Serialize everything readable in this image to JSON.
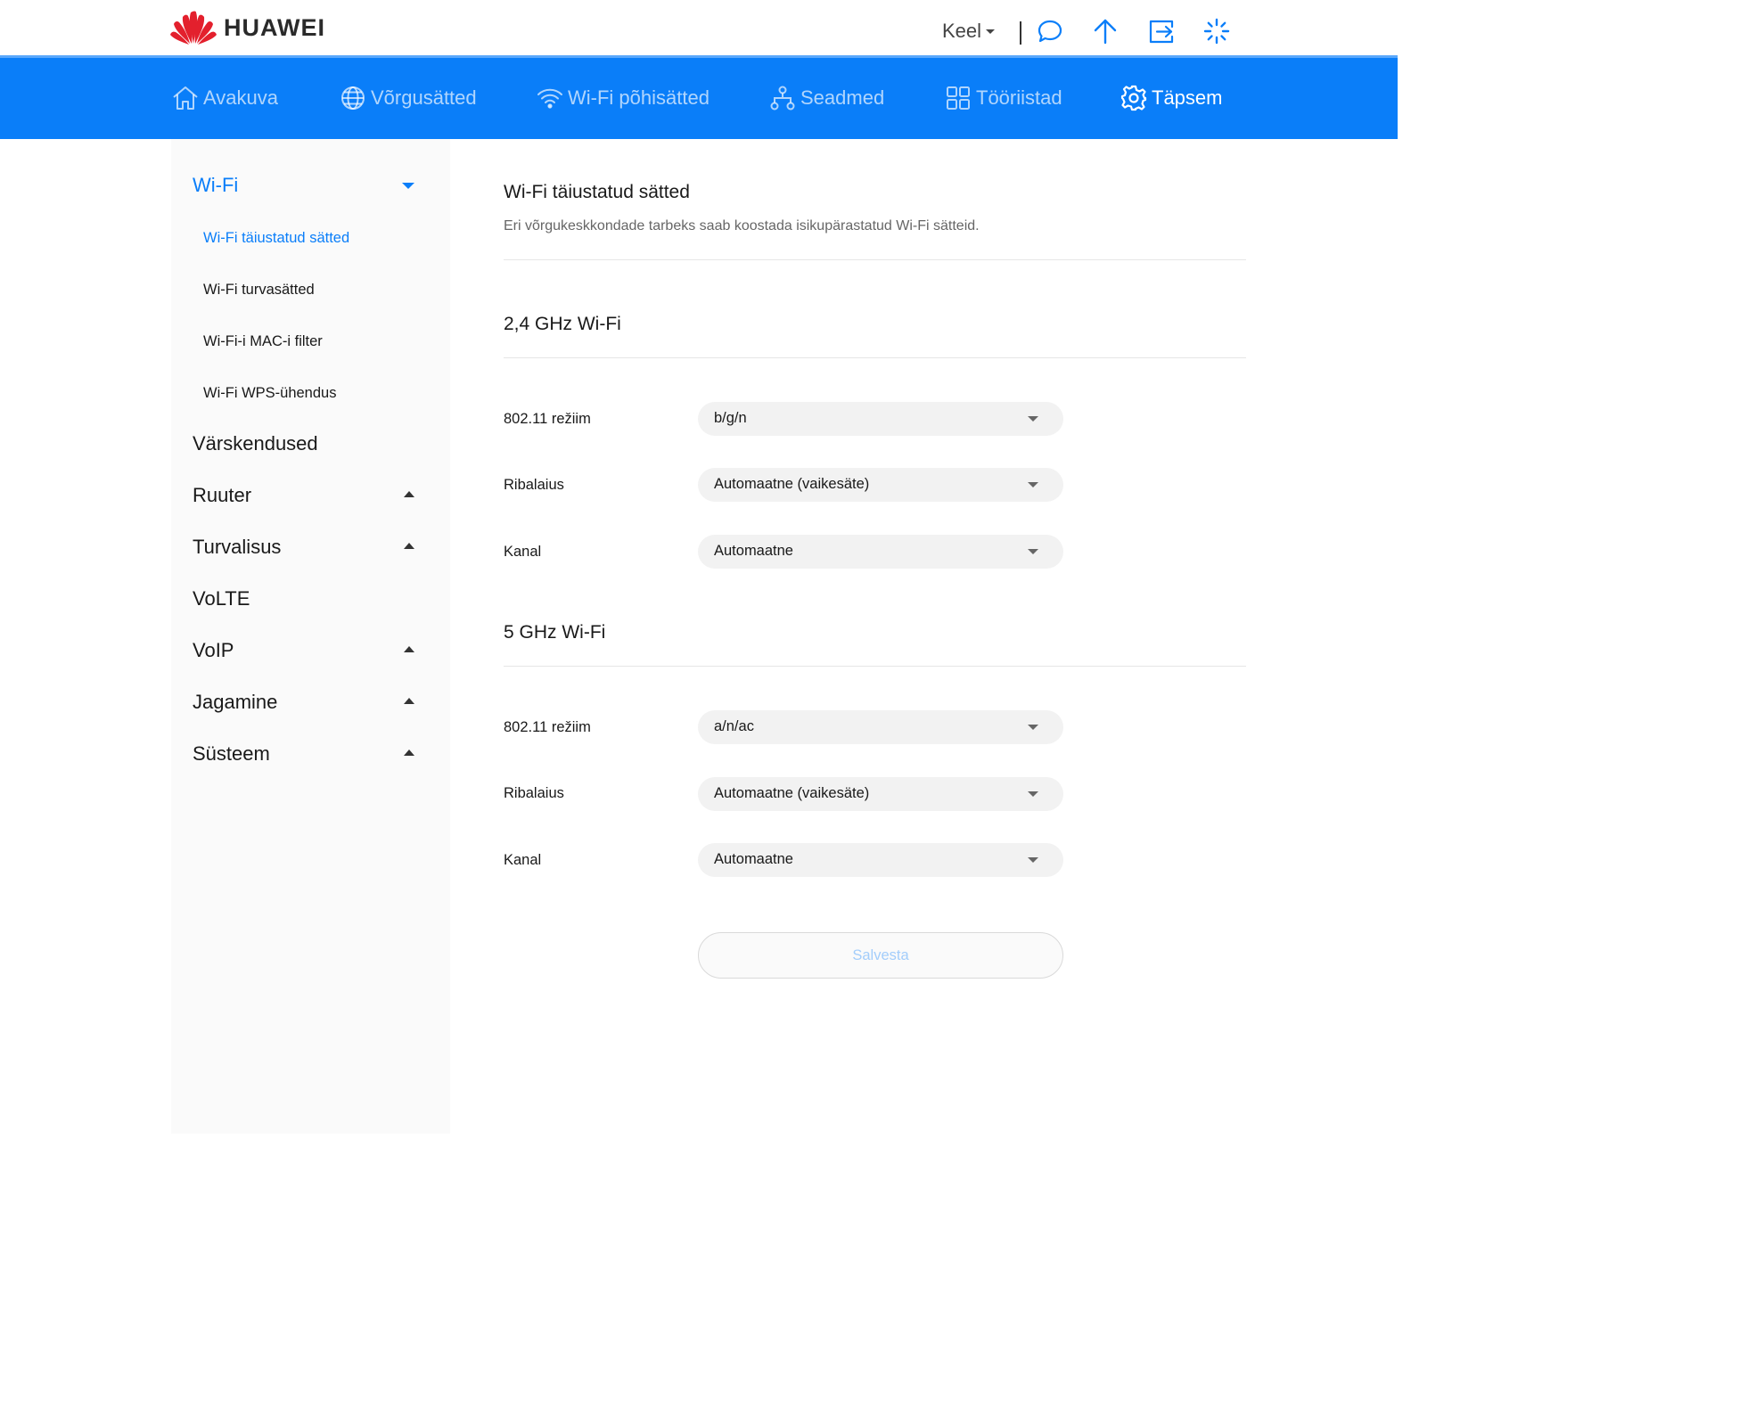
{
  "header": {
    "brand": "HUAWEI",
    "language_label": "Keel",
    "icons": [
      "message-icon",
      "upload-arrow-icon",
      "logout-icon",
      "loading-spinner-icon"
    ],
    "accent_color": "#0a7ef9"
  },
  "nav": {
    "items": [
      {
        "label": "Avakuva",
        "icon": "home-icon",
        "active": false
      },
      {
        "label": "Võrgusätted",
        "icon": "globe-icon",
        "active": false
      },
      {
        "label": "Wi-Fi põhisätted",
        "icon": "wifi-icon",
        "active": false
      },
      {
        "label": "Seadmed",
        "icon": "devices-icon",
        "active": false
      },
      {
        "label": "Tööriistad",
        "icon": "tools-grid-icon",
        "active": false
      },
      {
        "label": "Täpsem",
        "icon": "gear-icon",
        "active": true
      }
    ]
  },
  "sidebar": {
    "wifi_label": "Wi-Fi",
    "wifi_sub": [
      {
        "label": "Wi-Fi täiustatud sätted",
        "active": true
      },
      {
        "label": "Wi-Fi turvasätted",
        "active": false
      },
      {
        "label": "Wi-Fi-i MAC-i filter",
        "active": false
      },
      {
        "label": "Wi-Fi WPS-ühendus",
        "active": false
      }
    ],
    "sections": [
      {
        "label": "Värskendused",
        "expandable": false
      },
      {
        "label": "Ruuter",
        "expandable": true
      },
      {
        "label": "Turvalisus",
        "expandable": true
      },
      {
        "label": "VoLTE",
        "expandable": false
      },
      {
        "label": "VoIP",
        "expandable": true
      },
      {
        "label": "Jagamine",
        "expandable": true
      },
      {
        "label": "Süsteem",
        "expandable": true
      }
    ]
  },
  "main": {
    "title": "Wi-Fi täiustatud sätted",
    "description": "Eri võrgukeskkondade tarbeks saab koostada isikupärastatud Wi-Fi sätteid.",
    "band24": {
      "title": "2,4 GHz Wi-Fi",
      "rows": [
        {
          "label": "802.11 režiim",
          "value": "b/g/n"
        },
        {
          "label": "Ribalaius",
          "value": "Automaatne (vaikesäte)"
        },
        {
          "label": "Kanal",
          "value": "Automaatne"
        }
      ]
    },
    "band5": {
      "title": "5 GHz Wi-Fi",
      "rows": [
        {
          "label": "802.11 režiim",
          "value": "a/n/ac"
        },
        {
          "label": "Ribalaius",
          "value": "Automaatne (vaikesäte)"
        },
        {
          "label": "Kanal",
          "value": "Automaatne"
        }
      ]
    },
    "save_label": "Salvesta"
  }
}
